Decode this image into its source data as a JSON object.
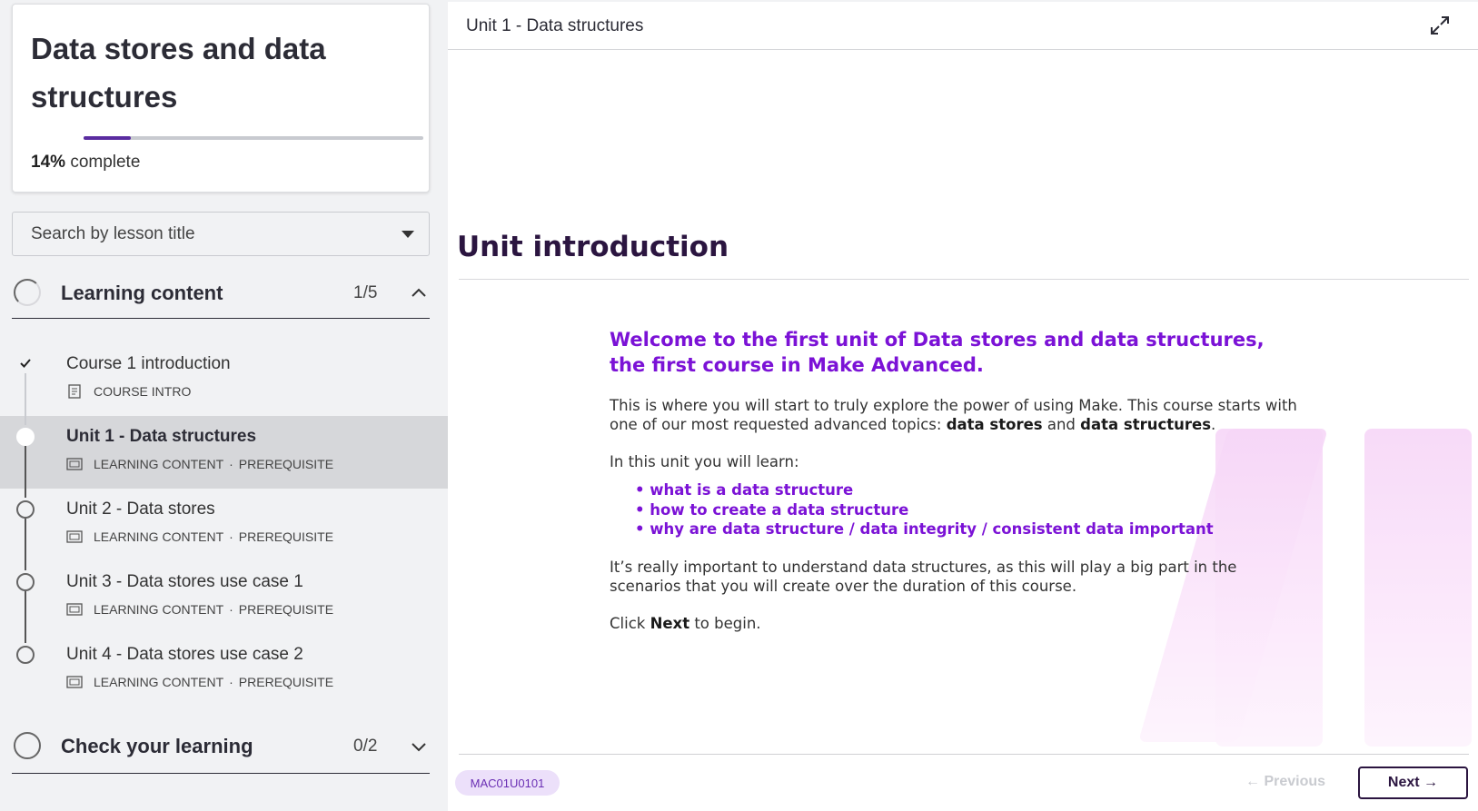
{
  "course": {
    "title": "Data stores and data structures",
    "progress_percent": 14,
    "progress_value": "14%",
    "progress_label": "complete"
  },
  "search": {
    "placeholder": "Search by lesson title"
  },
  "sections": [
    {
      "title": "Learning content",
      "count": "1/5",
      "expanded": true,
      "lessons": [
        {
          "name": "Course 1 introduction",
          "type": "COURSE INTRO",
          "prereq": "",
          "status": "done"
        },
        {
          "name": "Unit 1 - Data structures",
          "type": "LEARNING CONTENT",
          "prereq": "PREREQUISITE",
          "status": "current"
        },
        {
          "name": "Unit 2 - Data stores",
          "type": "LEARNING CONTENT",
          "prereq": "PREREQUISITE",
          "status": "todo"
        },
        {
          "name": "Unit 3 - Data stores use case 1",
          "type": "LEARNING CONTENT",
          "prereq": "PREREQUISITE",
          "status": "todo"
        },
        {
          "name": "Unit 4 - Data stores use case 2",
          "type": "LEARNING CONTENT",
          "prereq": "PREREQUISITE",
          "status": "todo"
        }
      ]
    },
    {
      "title": "Check your learning",
      "count": "0/2",
      "expanded": false
    }
  ],
  "main": {
    "breadcrumb": "Unit 1 - Data structures",
    "heading": "Unit introduction",
    "lead": "Welcome to the first unit of Data stores and data structures, the first course in Make Advanced.",
    "para1_pre": "This is where you will start to truly explore the power of using Make. This course starts with one of our most requested advanced topics: ",
    "para1_bold1": "data stores",
    "para1_mid": " and ",
    "para1_bold2": "data structures",
    "para1_end": ".",
    "learn_intro": "In this unit you will learn:",
    "learn_items": [
      "what is a data structure",
      "how to create a data structure",
      "why are data structure / data integrity / consistent data important"
    ],
    "para2": "It’s really important to understand data structures, as this will play a big part in the scenarios that you will create over the duration of this course.",
    "click_pre": "Click ",
    "click_bold": "Next",
    "click_post": " to begin.",
    "code": "MAC01U0101",
    "prev_label": "Previous",
    "next_label": "Next"
  },
  "colors": {
    "accent": "#7b12d6",
    "dark": "#2b1540",
    "deco": "#f6d6f7"
  }
}
